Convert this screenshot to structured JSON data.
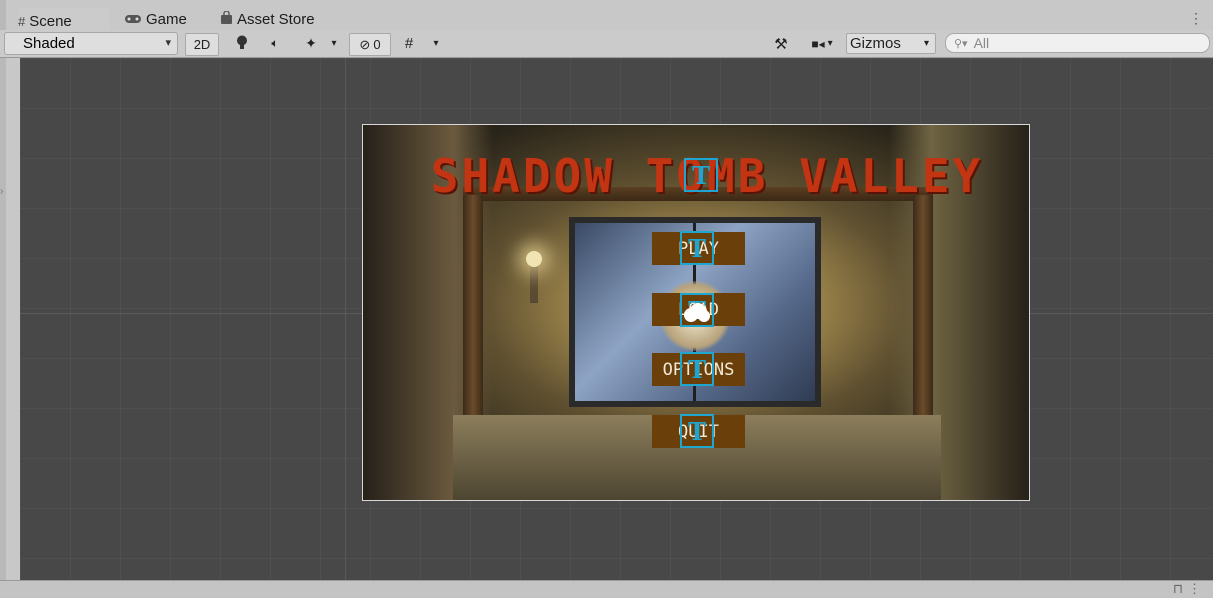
{
  "tabs": [
    {
      "label": "Scene",
      "icon": "hash-icon",
      "active": true
    },
    {
      "label": "Game",
      "icon": "gamepad-icon",
      "active": false
    },
    {
      "label": "Asset Store",
      "icon": "shopping-bag-icon",
      "active": false
    }
  ],
  "toolbar": {
    "draw_mode": "Shaded",
    "mode_2d": "2D",
    "hidden_count": "0",
    "gizmos": "Gizmos",
    "search_placeholder": "All"
  },
  "game": {
    "title": "SHADOW TOMB VALLEY",
    "buttons": [
      "PLAY",
      "LOAD",
      "OPTIONS",
      "QUIT"
    ]
  },
  "colors": {
    "title": "#c23412",
    "button_bg": "#6b3f09",
    "gizmo": "#1fa6d0",
    "viewport": "#484848"
  }
}
